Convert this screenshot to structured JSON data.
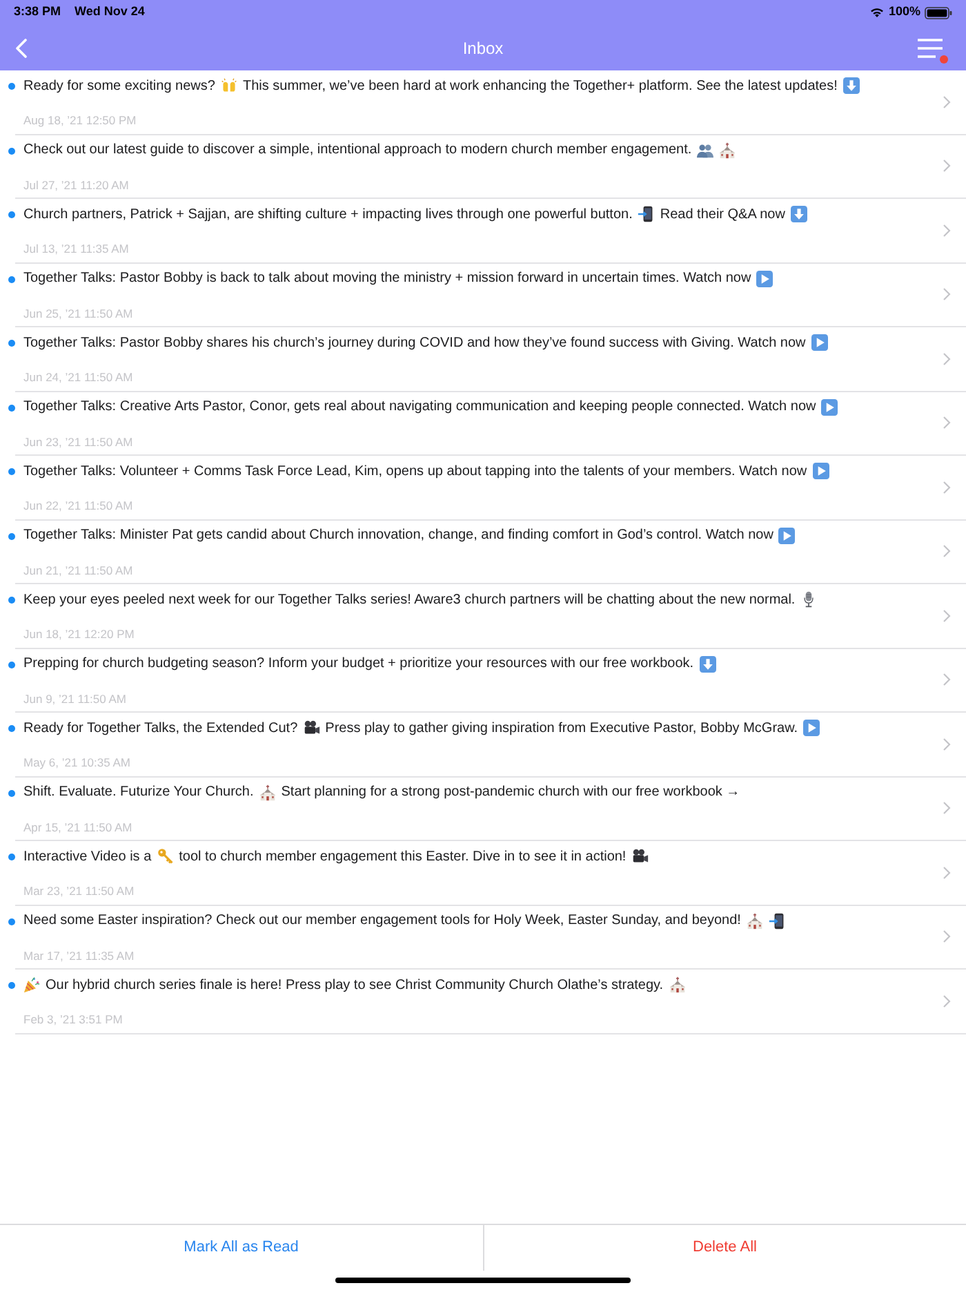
{
  "status_bar": {
    "time": "3:38 PM",
    "date": "Wed Nov 24",
    "battery": "100%"
  },
  "nav_bar": {
    "title": "Inbox",
    "menu_badge": true
  },
  "messages": [
    {
      "unread": true,
      "segments": [
        {
          "kind": "text",
          "text": "Ready for some exciting news?"
        },
        {
          "kind": "hands"
        },
        {
          "kind": "text",
          "text": "This summer, we’ve been hard at work enhancing the Together+ platform. See the latest updates!"
        },
        {
          "kind": "download"
        }
      ],
      "date": "Aug 18, ’21 12:50 PM"
    },
    {
      "unread": true,
      "segments": [
        {
          "kind": "text",
          "text": "Check out our latest guide to discover a simple, intentional approach to modern church member engagement."
        },
        {
          "kind": "people"
        },
        {
          "kind": "church"
        }
      ],
      "date": "Jul 27, ’21 11:20 AM"
    },
    {
      "unread": true,
      "segments": [
        {
          "kind": "text",
          "text": "Church partners, Patrick + Sajjan, are shifting culture + impacting lives through one powerful button."
        },
        {
          "kind": "phone"
        },
        {
          "kind": "text",
          "text": "Read their Q&A now"
        },
        {
          "kind": "download"
        }
      ],
      "date": "Jul 13, ’21 11:35 AM"
    },
    {
      "unread": true,
      "segments": [
        {
          "kind": "text",
          "text": "Together Talks: Pastor Bobby is back to talk about moving the ministry + mission forward in uncertain times. Watch now"
        },
        {
          "kind": "play"
        }
      ],
      "date": "Jun 25, ’21 11:50 AM"
    },
    {
      "unread": true,
      "segments": [
        {
          "kind": "text",
          "text": "Together Talks: Pastor Bobby shares his church’s journey during COVID and how they’ve found success with Giving. Watch now"
        },
        {
          "kind": "play"
        }
      ],
      "date": "Jun 24, ’21 11:50 AM"
    },
    {
      "unread": true,
      "segments": [
        {
          "kind": "text",
          "text": "Together Talks: Creative Arts Pastor, Conor, gets real about navigating communication and keeping people connected. Watch now"
        },
        {
          "kind": "play"
        }
      ],
      "date": "Jun 23, ’21 11:50 AM"
    },
    {
      "unread": true,
      "segments": [
        {
          "kind": "text",
          "text": "Together Talks: Volunteer + Comms Task Force Lead, Kim, opens up about tapping into the talents of your members. Watch now"
        },
        {
          "kind": "play"
        }
      ],
      "date": "Jun 22, ’21 11:50 AM"
    },
    {
      "unread": true,
      "segments": [
        {
          "kind": "text",
          "text": "Together Talks: Minister Pat gets candid about Church innovation, change, and finding comfort in God’s control. Watch now"
        },
        {
          "kind": "play"
        }
      ],
      "date": "Jun 21, ’21 11:50 AM"
    },
    {
      "unread": true,
      "segments": [
        {
          "kind": "text",
          "text": "Keep your eyes peeled next week for our Together Talks series! Aware3 church partners will be chatting about the new normal."
        },
        {
          "kind": "mic"
        }
      ],
      "date": "Jun 18, ’21 12:20 PM"
    },
    {
      "unread": true,
      "segments": [
        {
          "kind": "text",
          "text": "Prepping for church budgeting season? Inform your budget + prioritize your resources with our free workbook."
        },
        {
          "kind": "download"
        }
      ],
      "date": "Jun 9, ’21 11:50 AM"
    },
    {
      "unread": true,
      "segments": [
        {
          "kind": "text",
          "text": "Ready for Together Talks, the Extended Cut?"
        },
        {
          "kind": "camera"
        },
        {
          "kind": "text",
          "text": "Press play to gather giving inspiration from Executive Pastor, Bobby McGraw."
        },
        {
          "kind": "play"
        }
      ],
      "date": "May 6, ’21 10:35 AM"
    },
    {
      "unread": true,
      "segments": [
        {
          "kind": "text",
          "text": "Shift. Evaluate. Futurize Your Church."
        },
        {
          "kind": "church"
        },
        {
          "kind": "text",
          "text": "Start planning for a strong post-pandemic church with our free workbook →"
        }
      ],
      "date": "Apr 15, ’21 11:50 AM"
    },
    {
      "unread": true,
      "segments": [
        {
          "kind": "text",
          "text": "Interactive Video is a"
        },
        {
          "kind": "key"
        },
        {
          "kind": "text",
          "text": "tool to church member engagement this Easter. Dive in to see it in action!"
        },
        {
          "kind": "camera"
        }
      ],
      "date": "Mar 23, ’21 11:50 AM"
    },
    {
      "unread": true,
      "segments": [
        {
          "kind": "text",
          "text": "Need some Easter inspiration? Check out our member engagement tools for Holy Week, Easter Sunday, and beyond!"
        },
        {
          "kind": "church"
        },
        {
          "kind": "phone"
        }
      ],
      "date": "Mar 17, ’21 11:35 AM"
    },
    {
      "unread": true,
      "segments": [
        {
          "kind": "party"
        },
        {
          "kind": "text",
          "text": "Our hybrid church series finale is here! Press play to see Christ Community Church Olathe’s strategy."
        },
        {
          "kind": "church"
        }
      ],
      "date": "Feb 3, ’21 3:51 PM"
    }
  ],
  "footer": {
    "buttons": [
      {
        "label": "Mark All as Read",
        "kind": "primary"
      },
      {
        "label": "Delete All",
        "kind": "destructive"
      }
    ]
  }
}
